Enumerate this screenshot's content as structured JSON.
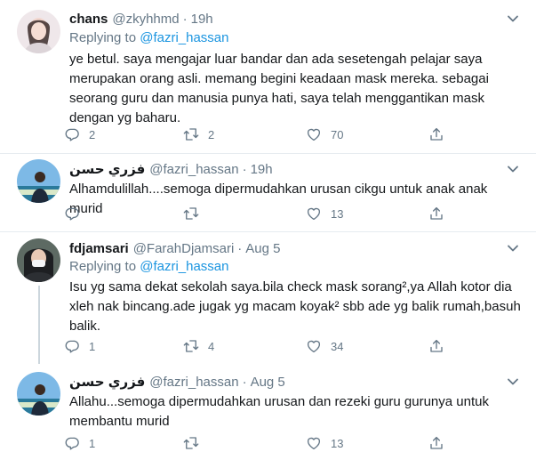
{
  "tweets": [
    {
      "name": "chans",
      "handle": "@zkyhhmd",
      "sep": "·",
      "time": "19h",
      "reply_prefix": "Replying to ",
      "reply_handle": "@fazri_hassan",
      "lines": [
        "ye betul. saya mengajar luar bandar dan ada sesetengah pelajar saya",
        "merupakan orang asli. memang begini keadaan mask mereka. sebagai",
        "seorang guru dan manusia punya hati, saya telah menggantikan mask",
        "dengan yg baharu."
      ],
      "reply_count": "2",
      "retweet_count": "2",
      "like_count": "70"
    },
    {
      "name": "فزري حسن",
      "handle": "@fazri_hassan",
      "sep": "·",
      "time": "19h",
      "lines": [
        "Alhamdulillah....semoga dipermudahkan urusan cikgu untuk anak anak murid"
      ],
      "reply_count": "",
      "retweet_count": "",
      "like_count": "13"
    },
    {
      "name": "fdjamsari",
      "handle": "@FarahDjamsari",
      "sep": "·",
      "time": "Aug 5",
      "reply_prefix": "Replying to ",
      "reply_handle": "@fazri_hassan",
      "lines": [
        "Isu yg sama dekat sekolah saya.bila check mask sorang²,ya Allah kotor dia",
        "xleh nak bincang.ade jugak yg macam koyak² sbb ade yg balik rumah,basuh",
        "balik."
      ],
      "reply_count": "1",
      "retweet_count": "4",
      "like_count": "34"
    },
    {
      "name": "فزري حسن",
      "handle": "@fazri_hassan",
      "sep": "·",
      "time": "Aug 5",
      "lines": [
        "Allahu...semoga dipermudahkan urusan dan rezeki guru gurunya untuk",
        "membantu murid"
      ],
      "reply_count": "1",
      "retweet_count": "",
      "like_count": "13"
    }
  ],
  "icons": {
    "reply": "reply-icon",
    "retweet": "retweet-icon",
    "like": "heart-icon",
    "share": "share-icon",
    "more": "chevron-down-icon"
  },
  "colors": {
    "link": "#1b95e0",
    "secondary": "#657786",
    "divider": "#e6ecf0"
  }
}
